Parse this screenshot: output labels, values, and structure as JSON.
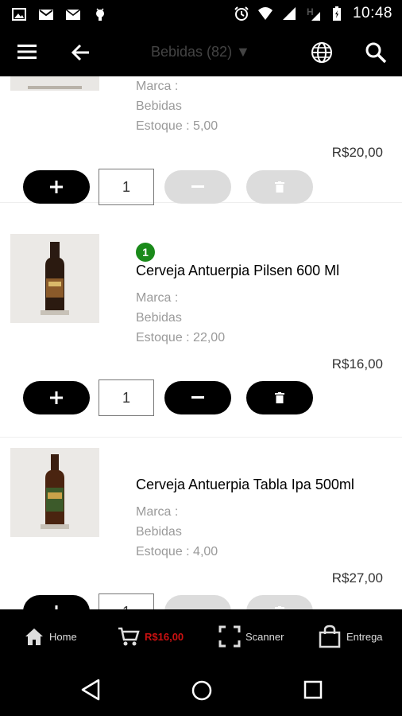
{
  "status_bar": {
    "time": "10:48",
    "left_icons": [
      "image-icon",
      "gmail-icon",
      "mail-icon",
      "android-icon"
    ],
    "right_icons": [
      "alarm-icon",
      "wifi-icon",
      "signal-icon",
      "h-network-icon",
      "battery-icon"
    ]
  },
  "app_bar": {
    "title": "Bebidas (82) ▼"
  },
  "products": [
    {
      "name": "",
      "marca_label": "Marca :",
      "category": "Bebidas",
      "stock": "Estoque : 5,00",
      "price": "R$20,00",
      "quantity": "1",
      "badge": "",
      "in_cart": false
    },
    {
      "name": "Cerveja Antuerpia Pilsen 600 Ml",
      "marca_label": "Marca :",
      "category": "Bebidas",
      "stock": "Estoque : 22,00",
      "price": "R$16,00",
      "quantity": "1",
      "badge": "1",
      "in_cart": true
    },
    {
      "name": "Cerveja Antuerpia Tabla Ipa 500ml",
      "marca_label": "Marca :",
      "category": "Bebidas",
      "stock": "Estoque : 4,00",
      "price": "R$27,00",
      "quantity": "1",
      "badge": "",
      "in_cart": false
    }
  ],
  "bottom_nav": {
    "home": "Home",
    "cart_total": "R$16,00",
    "scanner": "Scanner",
    "delivery": "Entrega"
  },
  "colors": {
    "cart_total": "#cc1111",
    "badge": "#1a8a1a",
    "disabled_button": "#dcdcdc"
  }
}
